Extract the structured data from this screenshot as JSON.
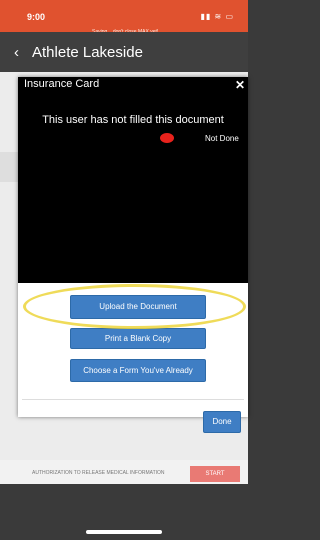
{
  "status_bar": {
    "time": "9:00",
    "saving_notice": "Saving... don't close MAX yet!",
    "icons": "▮▮ ≋ ▭"
  },
  "nav": {
    "back_glyph": "‹",
    "title": "Athlete Lakeside"
  },
  "modal": {
    "title": "Insurance Card",
    "close_glyph": "✕",
    "message": "This user has not filled this document",
    "status_label": "Not Done",
    "buttons": {
      "upload": "Upload the Document",
      "print": "Print a Blank Copy",
      "choose": "Choose a Form You've Already",
      "done": "Done"
    }
  },
  "background_row": {
    "label": "AUTHORIZATION TO RELEASE MEDICAL INFORMATION",
    "start": "START"
  },
  "colors": {
    "accent": "#e0522f",
    "button": "#3f7ec4",
    "not_done": "#e8221c",
    "highlight": "#ecd53c"
  }
}
